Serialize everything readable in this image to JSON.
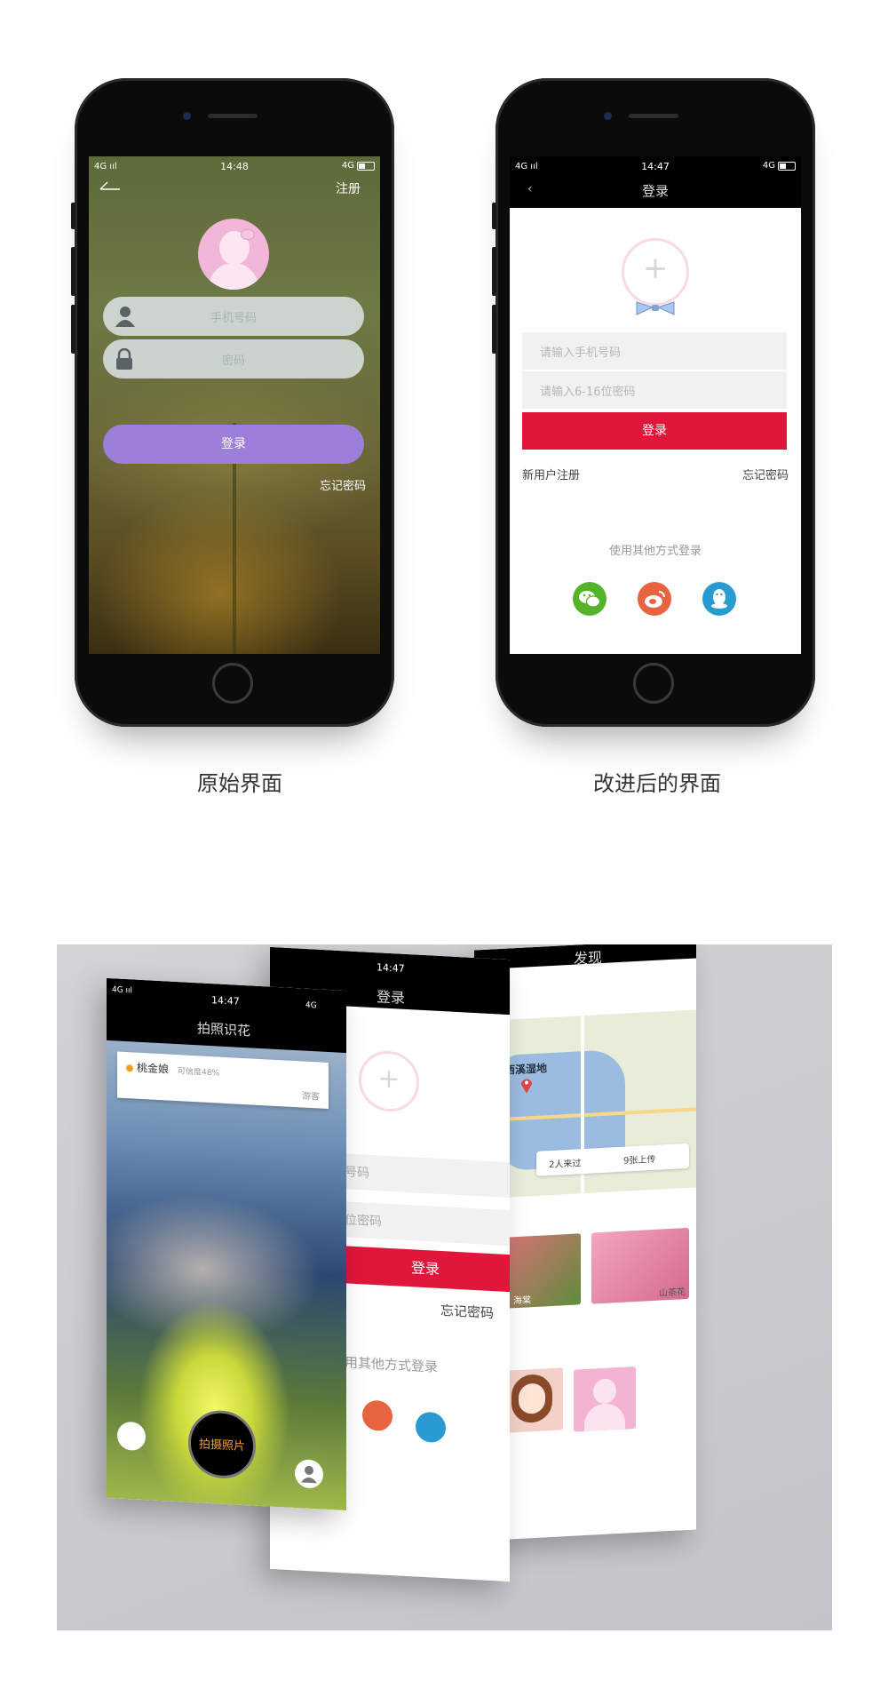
{
  "captions": {
    "original": "原始界面",
    "improved": "改进后的界面"
  },
  "original_screen": {
    "status": {
      "signal": "4G ııl",
      "time": "14:48",
      "network": "4G"
    },
    "register_label": "注册",
    "phone_placeholder": "手机号码",
    "password_placeholder": "密码",
    "login_button": "登录",
    "forgot_password": "忘记密码"
  },
  "improved_screen": {
    "status": {
      "signal": "4G ııl",
      "time": "14:47",
      "network": "4G"
    },
    "back_glyph": "‹",
    "title": "登录",
    "avatar_plus": "+",
    "phone_placeholder": "请输入手机号码",
    "password_placeholder": "请输入6-16位密码",
    "login_button": "登录",
    "new_user_register": "新用户注册",
    "forgot_password": "忘记密码",
    "other_methods": "使用其他方式登录",
    "social_logins": [
      {
        "name": "wechat",
        "color": "#55b32b"
      },
      {
        "name": "weibo",
        "color": "#e8633f"
      },
      {
        "name": "qq",
        "color": "#2a9ad2"
      }
    ]
  },
  "composite": {
    "front_screen": {
      "status": {
        "signal": "4G ııl",
        "time": "14:47",
        "network": "4G"
      },
      "title": "拍照识花",
      "result_name": "桃金娘",
      "result_confidence": "可信度48%",
      "result_user": "游客",
      "shoot_button": "拍摄照片"
    },
    "middle_screen": {
      "time": "14:47",
      "title": "登录",
      "phone_fragment": "号码",
      "password_fragment": "位密码",
      "login_button": "登录",
      "forgot_password": "忘记密码",
      "other_methods_fragment": "用其他方式登录"
    },
    "back_screen": {
      "title": "发现",
      "map_label": "西溪湿地",
      "filter_people": "2人来过",
      "filter_photos": "9张上传",
      "flower_1": "海棠",
      "flower_2": "山茶花"
    }
  },
  "colors": {
    "old_login": "#9b7fd8",
    "new_login": "#e0163a",
    "shoot_text": "#f0a020"
  }
}
